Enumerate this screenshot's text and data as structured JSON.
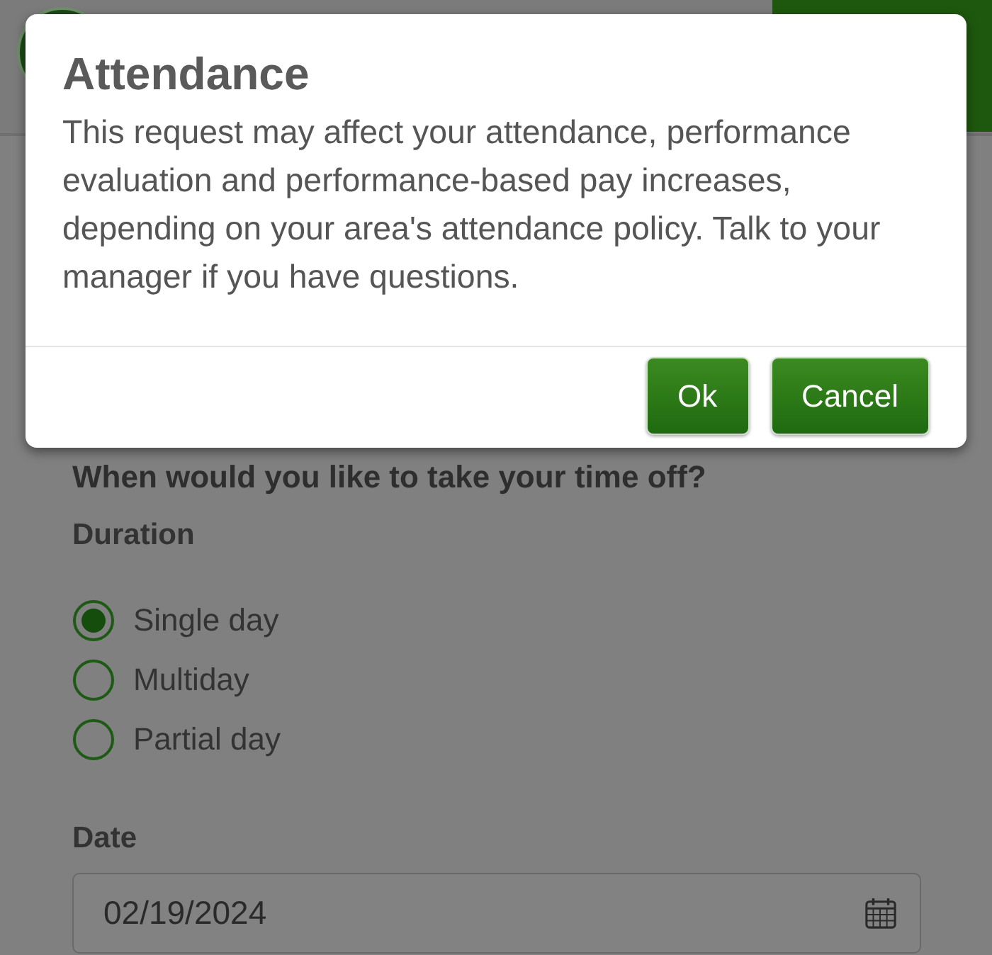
{
  "dialog": {
    "title": "Attendance",
    "message": "This request may affect your attendance, performance evaluation and performance-based pay increases, depending on your area's attendance policy. Talk to your manager if you have questions.",
    "buttons": [
      {
        "label": "Ok"
      },
      {
        "label": "Cancel"
      }
    ]
  },
  "form": {
    "question": "When would you like to take your time off?",
    "duration_label": "Duration",
    "duration_options": [
      {
        "label": "Single day",
        "selected": true
      },
      {
        "label": "Multiday",
        "selected": false
      },
      {
        "label": "Partial day",
        "selected": false
      }
    ],
    "date_label": "Date",
    "date_field": {
      "value": "02/19/2024"
    }
  }
}
